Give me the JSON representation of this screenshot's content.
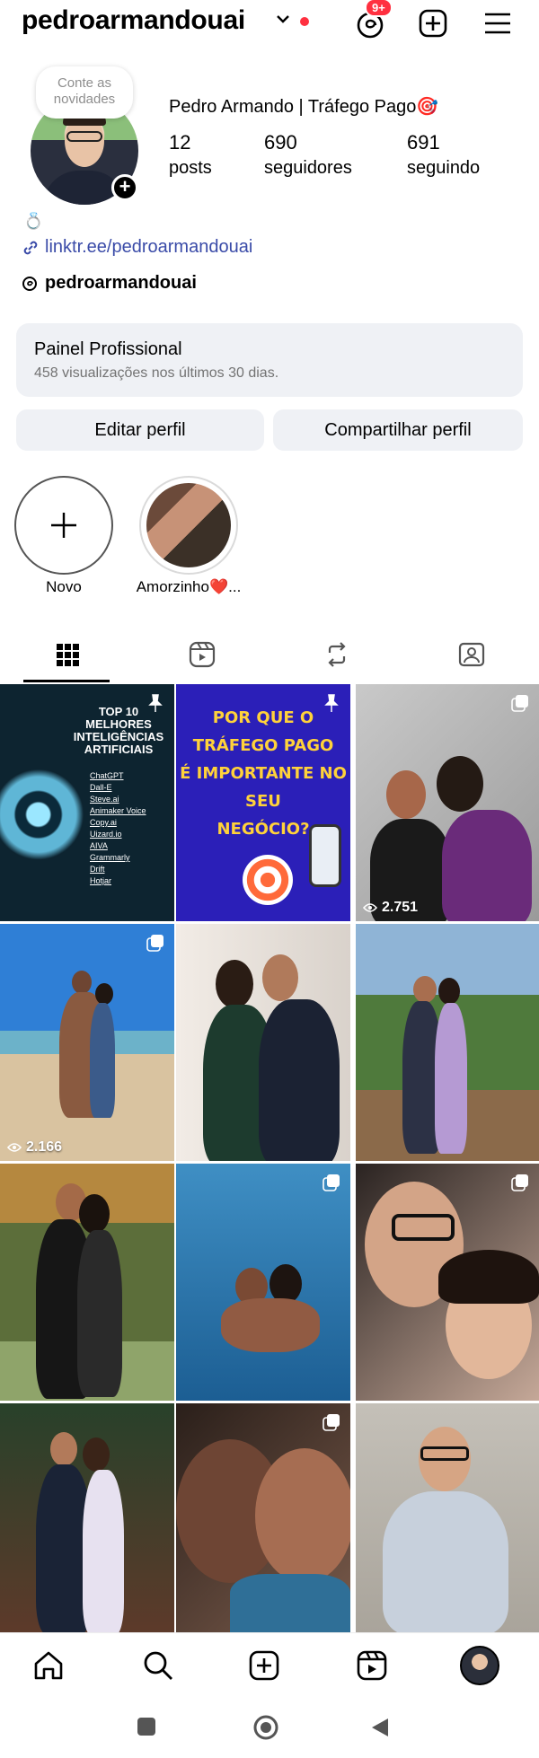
{
  "header": {
    "username": "pedroarmandouai",
    "notification_badge": "9+",
    "icons": [
      "chevron-down-icon",
      "threads-icon",
      "create-icon",
      "menu-icon"
    ],
    "accent_red": "#ff3040"
  },
  "profile": {
    "note_bubble": "Conte as novidades",
    "display_name": "Pedro Armando | Tráfego Pago🎯",
    "stats": [
      {
        "value": "12",
        "label": "posts"
      },
      {
        "value": "690",
        "label": "seguidores"
      },
      {
        "value": "691",
        "label": "seguindo"
      }
    ],
    "bio_emoji": "💍",
    "link": "linktr.ee/pedroarmandouai",
    "threads_handle": "pedroarmandouai",
    "link_color": "#3a4ba8"
  },
  "panel": {
    "title": "Painel Profissional",
    "subtitle": "458 visualizações nos últimos 30 dias."
  },
  "buttons": {
    "edit": "Editar perfil",
    "share": "Compartilhar perfil"
  },
  "highlights": [
    {
      "label": "Novo"
    },
    {
      "label": "Amorzinho❤️..."
    }
  ],
  "tabs": [
    "grid-icon",
    "reels-icon",
    "reposts-icon",
    "tagged-icon"
  ],
  "posts": [
    {
      "type": "pinned",
      "text_lines": [
        "TOP 10 MELHORES",
        "INTELIGÊNCIAS",
        "ARTIFICIAIS"
      ],
      "list": [
        "ChatGPT",
        "Dall-E",
        "Steve.ai",
        "Animaker Voice",
        "Copy.ai",
        "Uizard.io",
        "AIVA",
        "Grammarly",
        "Drift",
        "Hotjar"
      ]
    },
    {
      "type": "pinned",
      "text_lines": [
        "POR QUE O TRÁFEGO PAGO",
        "É IMPORTANTE NO SEU",
        "NEGÓCIO?"
      ]
    },
    {
      "type": "carousel",
      "views": "2.751"
    },
    {
      "type": "carousel",
      "views": "2.166"
    },
    {
      "type": "photo"
    },
    {
      "type": "photo"
    },
    {
      "type": "photo"
    },
    {
      "type": "carousel"
    },
    {
      "type": "carousel"
    },
    {
      "type": "photo"
    },
    {
      "type": "carousel"
    },
    {
      "type": "photo"
    }
  ],
  "bottom_nav": [
    "home-icon",
    "search-icon",
    "create-icon",
    "reels-icon",
    "profile-avatar"
  ]
}
